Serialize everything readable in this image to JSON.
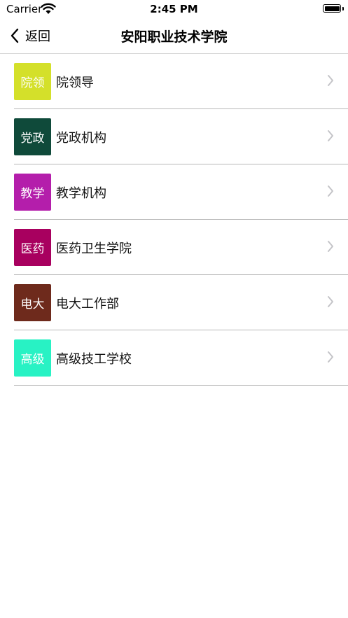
{
  "status_bar": {
    "carrier": "Carrier",
    "time": "2:45 PM",
    "icons": [
      "wifi-icon",
      "battery-icon"
    ]
  },
  "nav": {
    "back_label": "返回",
    "title": "安阳职业技术学院",
    "back_icon": "chevron-left-icon"
  },
  "items": [
    {
      "tile": "院领",
      "label": "院领导",
      "color": "#d4e02a"
    },
    {
      "tile": "党政",
      "label": "党政机构",
      "color": "#0f4a3a"
    },
    {
      "tile": "教学",
      "label": "教学机构",
      "color": "#b41eab"
    },
    {
      "tile": "医药",
      "label": "医药卫生学院",
      "color": "#a8005f"
    },
    {
      "tile": "电大",
      "label": "电大工作部",
      "color": "#6e2a1c"
    },
    {
      "tile": "高级",
      "label": "高级技工学校",
      "color": "#28f2c4"
    }
  ],
  "row_icon": "chevron-right-icon"
}
